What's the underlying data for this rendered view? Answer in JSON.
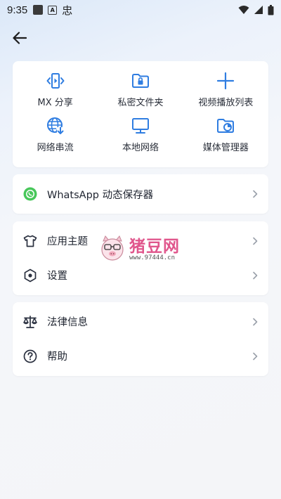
{
  "status_bar": {
    "time": "9:35",
    "icons": [
      "app-square-icon",
      "a-icon",
      "chinese-glyph-icon",
      "wifi-icon",
      "signal-icon",
      "battery-icon"
    ],
    "glyph": "忠"
  },
  "header": {
    "back_icon": "arrow-left-icon"
  },
  "quick_actions": [
    {
      "label": "MX 分享",
      "icon": "mx-share-icon"
    },
    {
      "label": "私密文件夹",
      "icon": "private-folder-icon"
    },
    {
      "label": "视频播放列表",
      "icon": "plus-icon"
    },
    {
      "label": "网络串流",
      "icon": "network-stream-icon"
    },
    {
      "label": "本地网络",
      "icon": "local-network-icon"
    },
    {
      "label": "媒体管理器",
      "icon": "media-manager-icon"
    }
  ],
  "whatsapp": {
    "label": "WhatsApp 动态保存器",
    "icon": "whatsapp-icon"
  },
  "settings_menu": [
    {
      "label": "应用主题",
      "icon": "shirt-icon"
    },
    {
      "label": "设置",
      "icon": "hexagon-settings-icon"
    }
  ],
  "legal_menu": [
    {
      "label": "法律信息",
      "icon": "scales-icon"
    },
    {
      "label": "帮助",
      "icon": "help-icon"
    }
  ],
  "watermark": {
    "title": "猪豆网",
    "url": "www.97444.cn"
  },
  "colors": {
    "accent": "#2f7de1",
    "whatsapp_green": "#48c75a",
    "icon_dark": "#2b3140",
    "chevron": "#9aa0aa"
  }
}
